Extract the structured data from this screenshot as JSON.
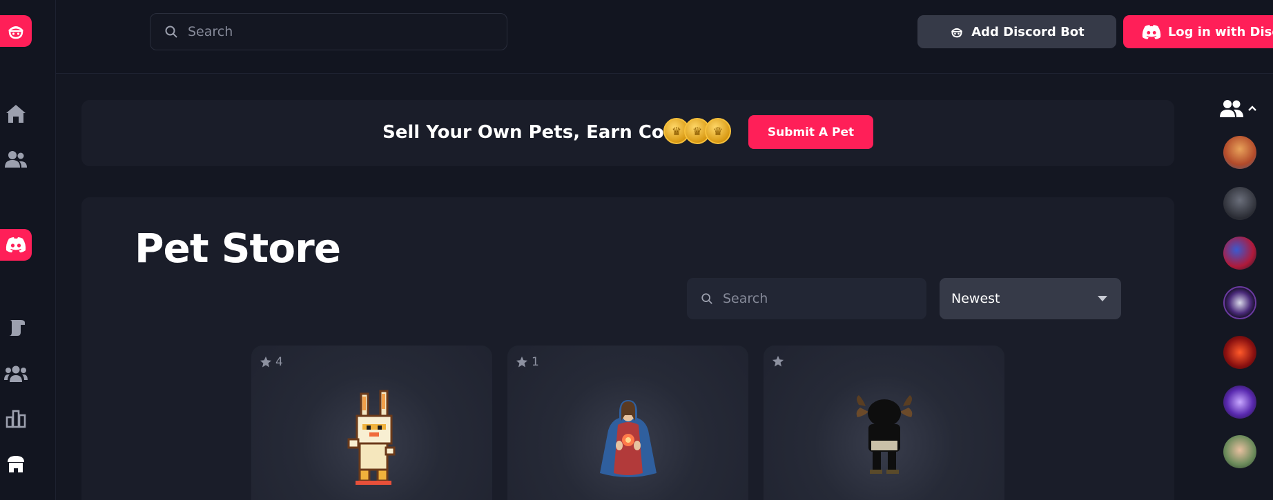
{
  "topbar": {
    "search_placeholder": "Search",
    "add_bot_label": "Add Discord Bot",
    "login_label": "Log in with Discord"
  },
  "sidebar": {
    "items": [
      {
        "icon": "home-icon"
      },
      {
        "icon": "users-icon"
      },
      {
        "icon": "discord-icon"
      },
      {
        "icon": "scroll-icon"
      },
      {
        "icon": "group-icon"
      },
      {
        "icon": "leaderboard-icon"
      },
      {
        "icon": "store-icon"
      }
    ]
  },
  "banner": {
    "text": "Sell Your Own Pets, Earn Coins",
    "submit_label": "Submit A Pet"
  },
  "store": {
    "title": "Pet Store",
    "search_placeholder": "Search",
    "sort_selected": "Newest",
    "cards": [
      {
        "stars": "4",
        "pet": "scorbunny-pixel-sprite"
      },
      {
        "stars": "1",
        "pet": "sacred-heart-figure"
      },
      {
        "stars": "",
        "pet": "moose-character"
      }
    ]
  },
  "friends": {
    "avatars": [
      "avatar-1",
      "avatar-2",
      "avatar-3",
      "avatar-4",
      "avatar-5",
      "avatar-6",
      "avatar-7"
    ]
  },
  "colors": {
    "accent": "#ff1f58",
    "background": "#141722",
    "panel": "#1a1d29",
    "secondary_button": "#363a48"
  }
}
